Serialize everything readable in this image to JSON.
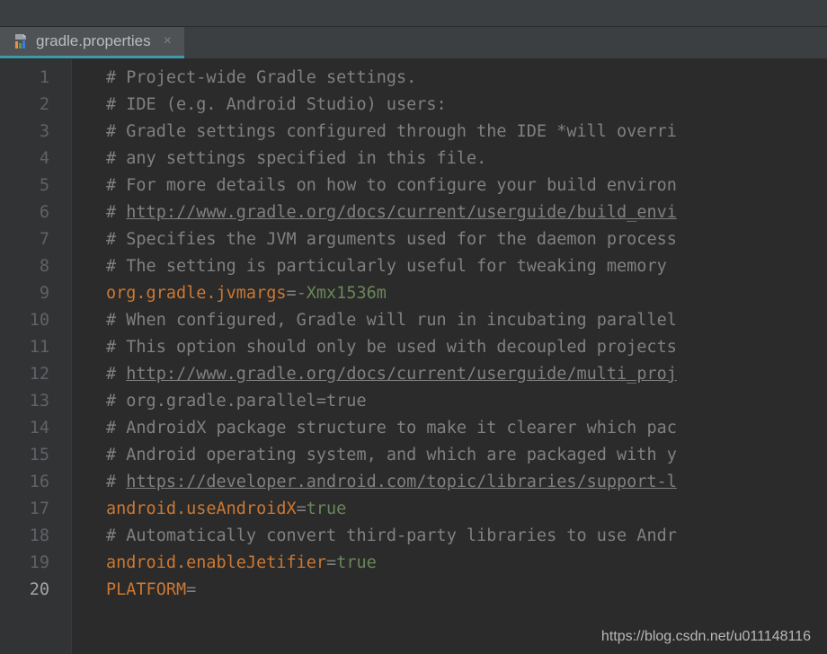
{
  "tab": {
    "filename": "gradle.properties",
    "close_glyph": "×"
  },
  "footer": {
    "url": "https://blog.csdn.net/u011148116"
  },
  "gutter": {
    "start": 1,
    "end": 20,
    "active": 20
  },
  "icon_bars": [
    "#f08c3b",
    "#4aa147",
    "#3b7dd8"
  ],
  "lines": [
    {
      "n": 1,
      "segs": [
        {
          "cls": "comment",
          "t": "# Project-wide Gradle settings."
        }
      ]
    },
    {
      "n": 2,
      "segs": [
        {
          "cls": "comment",
          "t": "# IDE (e.g. Android Studio) users:"
        }
      ]
    },
    {
      "n": 3,
      "segs": [
        {
          "cls": "comment",
          "t": "# Gradle settings configured through the IDE *will overri"
        }
      ]
    },
    {
      "n": 4,
      "segs": [
        {
          "cls": "comment",
          "t": "# any settings specified in this file."
        }
      ]
    },
    {
      "n": 5,
      "segs": [
        {
          "cls": "comment",
          "t": "# For more details on how to configure your build environ"
        }
      ]
    },
    {
      "n": 6,
      "segs": [
        {
          "cls": "comment",
          "t": "# "
        },
        {
          "cls": "link",
          "t": "http://www.gradle.org/docs/current/userguide/build_envi"
        }
      ]
    },
    {
      "n": 7,
      "segs": [
        {
          "cls": "comment",
          "t": "# Specifies the JVM arguments used for the daemon process"
        }
      ]
    },
    {
      "n": 8,
      "segs": [
        {
          "cls": "comment",
          "t": "# The setting is particularly useful for tweaking memory "
        }
      ]
    },
    {
      "n": 9,
      "segs": [
        {
          "cls": "key",
          "t": "org.gradle.jvmargs"
        },
        {
          "cls": "eq",
          "t": "="
        },
        {
          "cls": "val",
          "t": "-Xmx1536m"
        }
      ]
    },
    {
      "n": 10,
      "segs": [
        {
          "cls": "comment",
          "t": "# When configured, Gradle will run in incubating parallel"
        }
      ]
    },
    {
      "n": 11,
      "segs": [
        {
          "cls": "comment",
          "t": "# This option should only be used with decoupled projects"
        }
      ]
    },
    {
      "n": 12,
      "segs": [
        {
          "cls": "comment",
          "t": "# "
        },
        {
          "cls": "link",
          "t": "http://www.gradle.org/docs/current/userguide/multi_proj"
        }
      ]
    },
    {
      "n": 13,
      "segs": [
        {
          "cls": "comment",
          "t": "# org.gradle.parallel=true"
        }
      ]
    },
    {
      "n": 14,
      "segs": [
        {
          "cls": "comment",
          "t": "# AndroidX package structure to make it clearer which pac"
        }
      ]
    },
    {
      "n": 15,
      "segs": [
        {
          "cls": "comment",
          "t": "# Android operating system, and which are packaged with y"
        }
      ]
    },
    {
      "n": 16,
      "segs": [
        {
          "cls": "comment",
          "t": "# "
        },
        {
          "cls": "link",
          "t": "https://developer.android.com/topic/libraries/support-l"
        }
      ]
    },
    {
      "n": 17,
      "segs": [
        {
          "cls": "key",
          "t": "android.useAndroidX"
        },
        {
          "cls": "eq",
          "t": "="
        },
        {
          "cls": "val",
          "t": "true"
        }
      ]
    },
    {
      "n": 18,
      "segs": [
        {
          "cls": "comment",
          "t": "# Automatically convert third-party libraries to use Andr"
        }
      ]
    },
    {
      "n": 19,
      "segs": [
        {
          "cls": "key",
          "t": "android.enableJetifier"
        },
        {
          "cls": "eq",
          "t": "="
        },
        {
          "cls": "val",
          "t": "true"
        }
      ]
    },
    {
      "n": 20,
      "segs": [
        {
          "cls": "key",
          "t": "PLATFORM"
        },
        {
          "cls": "eq",
          "t": "="
        }
      ]
    }
  ]
}
